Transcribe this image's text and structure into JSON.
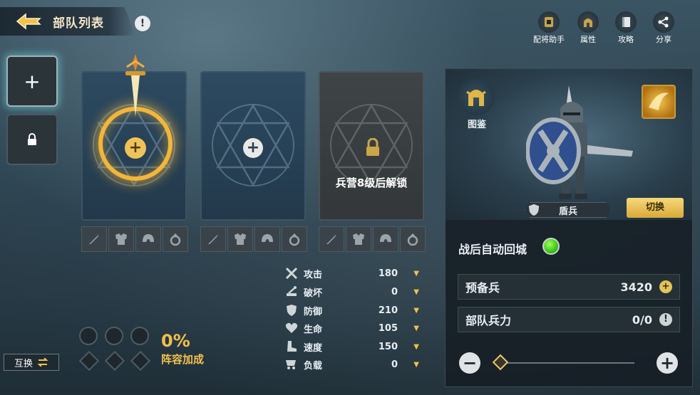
{
  "header": {
    "title": "部队列表",
    "info_icon": "!"
  },
  "toolbar": {
    "tools": [
      {
        "label": "配将助手",
        "icon": "helper-icon"
      },
      {
        "label": "属性",
        "icon": "helmet-icon"
      },
      {
        "label": "攻略",
        "icon": "book-icon"
      },
      {
        "label": "分享",
        "icon": "share-icon"
      }
    ]
  },
  "left_slots": {
    "add_symbol": "+"
  },
  "swap_button": {
    "label": "互换"
  },
  "cards": {
    "locked_text": "兵营8级后解锁"
  },
  "stats": [
    {
      "name": "攻击",
      "value": "180",
      "icon": "swords-icon"
    },
    {
      "name": "破坏",
      "value": "0",
      "icon": "catapult-icon"
    },
    {
      "name": "防御",
      "value": "210",
      "icon": "shield-icon"
    },
    {
      "name": "生命",
      "value": "105",
      "icon": "heart-icon"
    },
    {
      "name": "速度",
      "value": "150",
      "icon": "boot-icon"
    },
    {
      "name": "负载",
      "value": "0",
      "icon": "cart-icon"
    }
  ],
  "formation": {
    "percent": "0%",
    "label": "阵容加成"
  },
  "panel": {
    "codex_label": "图鉴",
    "unit_name": "盾兵",
    "switch_label": "切换",
    "auto_return_label": "战后自动回城",
    "reserve": {
      "label": "预备兵",
      "value": "3420"
    },
    "troop_power": {
      "label": "部队兵力",
      "value": "0/0"
    }
  },
  "colors": {
    "accent_gold": "#f2c04c",
    "toggle_green": "#3cc418"
  }
}
